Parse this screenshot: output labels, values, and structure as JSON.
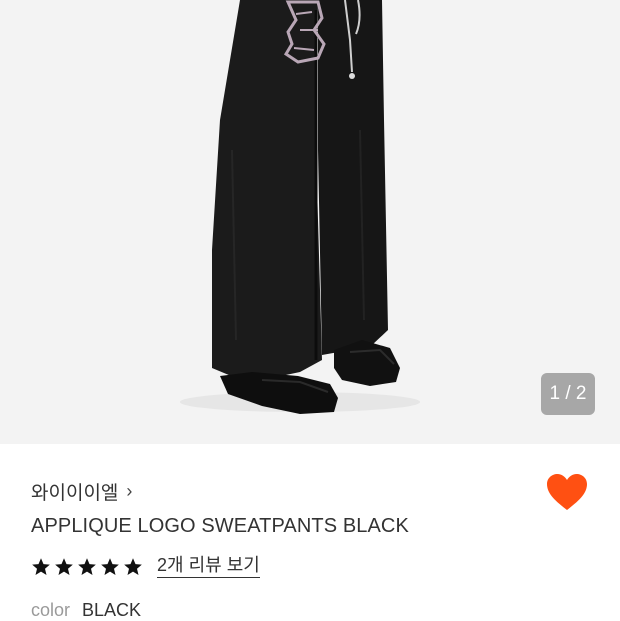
{
  "product_image": {
    "page_indicator": "1 / 2",
    "icon": "product-photo"
  },
  "product": {
    "brand": "와이이이엘",
    "brand_chevron": "›",
    "name": "APPLIQUE LOGO SWEATPANTS BLACK",
    "rating_stars": 5,
    "review_link": "2개 리뷰 보기",
    "color_label": "color",
    "color_value": "BLACK"
  },
  "colors": {
    "heart": "#FF5012",
    "star": "#111111",
    "background_photo": "#F3F3F3"
  }
}
